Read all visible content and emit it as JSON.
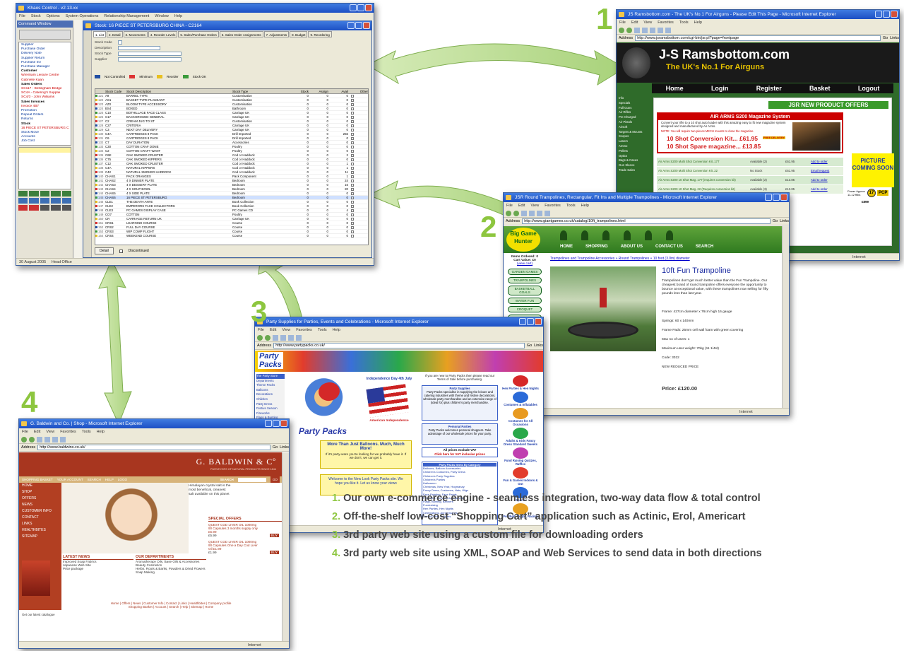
{
  "win_app": {
    "title": "Khaos Control - v2.13.xx",
    "menu": [
      "File",
      "Stock",
      "Options",
      "System Operations",
      "Relationship Management",
      "Window",
      "Help"
    ],
    "stock_title": "Stock: 16 PIECE ST PETERSBURG CHINA - C2164",
    "tabs": [
      "1. List",
      "2. Detail",
      "3. Movements",
      "4. Reorder Levels",
      "5. Sales/Purchase Orders",
      "6. Sales Order Assignments",
      "7. Adjustments",
      "8. Budget",
      "9. Reordering"
    ],
    "command_title": "Command Window",
    "command_links": [
      "Supplier",
      "Purchase Order",
      "Delivery Note",
      "Supplier Return",
      "Purchase Inv",
      "Purchase Manager",
      "Customer",
      "Wrenham Leisure Centre",
      "Gabrielle Kaan",
      "Sales Orders",
      "SC117 - Bellingham Bridge",
      "SC4A - Catering's Supplie",
      "SC4/3 - John Williams",
      "Sales Invoices",
      "Invoice 4B7",
      "Promotion",
      "Repeat Orders",
      "Returns",
      "Stock",
      "16 PIECE ST PETERSBURG C",
      "Stock Move",
      "Accounts",
      "Job Cost"
    ],
    "form_labels": [
      "Stock Code",
      "Description",
      "Stock Type",
      "Supplier"
    ],
    "status_legend": [
      "Not Controlled",
      "Minimum",
      "Reorder",
      "Stock OK"
    ],
    "grid_headers": [
      "Stock Code",
      "Stock Description",
      "Stock Type",
      "Stock",
      "Assign",
      "Avail",
      "Other"
    ],
    "grid_rows": [
      [
        "121",
        "A9",
        "BARREL TYPE",
        "Customisation",
        "0",
        "0",
        "0"
      ],
      [
        "122",
        "AS1",
        "BASKET TYPE PLANSANT",
        "Customisation",
        "0",
        "0",
        "0"
      ],
      [
        "123",
        "AZ0",
        "BLOOM TYPE ACCESSORY",
        "Customisation",
        "0",
        "0",
        "0"
      ],
      [
        "124",
        "BS4",
        "BOXED",
        "Bathroom",
        "0",
        "0",
        "0"
      ],
      [
        "125",
        "C10",
        "BOTHILLAGE FACE CLASS",
        "Carriage UK",
        "0",
        "0",
        "0"
      ],
      [
        "126",
        "C17",
        "BACKGROUND GENERAL",
        "Carriage UK",
        "0",
        "0",
        "0"
      ],
      [
        "127",
        "C2",
        "CREAM JUG TO ST",
        "Customisation",
        "0",
        "0",
        "0"
      ],
      [
        "128",
        "C27",
        "CRITERIA",
        "Carriage UK",
        "0",
        "0",
        "0"
      ],
      [
        "129",
        "C3",
        "NEXT DAY DELIVERY",
        "Carriage UK",
        "0",
        "0",
        "0"
      ],
      [
        "130",
        "C4A",
        "CARTRIDGES 8 PACK",
        "Drill Imported",
        "0",
        "0",
        "256"
      ],
      [
        "131",
        "C6",
        "CARTRIDGES 8 PACK",
        "Drill Imported",
        "0",
        "0",
        "0"
      ],
      [
        "132",
        "C7",
        "DAY DURATION",
        "Accessories",
        "0",
        "0",
        "0"
      ],
      [
        "133",
        "C30",
        "COTTON CRAF DONE",
        "Poultry",
        "0",
        "0",
        "0"
      ],
      [
        "134",
        "C2",
        "COTTON CRAFT WANT",
        "Poultry",
        "0",
        "0",
        "0"
      ],
      [
        "135",
        "C6E",
        "OAK SMOKED CRUSTER",
        "Cod or Haddock",
        "0",
        "0",
        "2"
      ],
      [
        "136",
        "C75",
        "OAK SMOKED KIPPERS",
        "Cod or Haddock",
        "0",
        "0",
        "0"
      ],
      [
        "137",
        "C12",
        "OAK SMOKED CRUSTER",
        "Cod or Haddock",
        "0",
        "0",
        "1"
      ],
      [
        "138",
        "C4A",
        "NATURAL KIPPERS",
        "Cod or Haddock",
        "0",
        "0",
        "1"
      ],
      [
        "139",
        "C42",
        "NATURAL SMOKED HADDOCK",
        "Cod or Haddock",
        "0",
        "0",
        "11"
      ],
      [
        "140",
        "CHAS1",
        "PACK ORANGES",
        "Pack Component",
        "0",
        "0",
        "1"
      ],
      [
        "141",
        "CHAS2",
        "4 X DINNER PLATE",
        "Bedroom",
        "0",
        "0",
        "24"
      ],
      [
        "142",
        "CHAS3",
        "4 X DESSERT PLATE",
        "Bedroom",
        "0",
        "0",
        "16"
      ],
      [
        "143",
        "CHAS4",
        "4 X SOUP BOWL",
        "Bedroom",
        "0",
        "0",
        "20"
      ],
      [
        "144",
        "CHAS5",
        "4 X SIDE PLATE",
        "Bedroom",
        "0",
        "0",
        "0"
      ],
      [
        "145",
        "CHAS6",
        "16 PIECE ST PETERSBURG",
        "Bedroom",
        "0",
        "0",
        "0"
      ],
      [
        "146",
        "CLE1",
        "THE DEATH ANTE",
        "Book Collection",
        "0",
        "0",
        "0"
      ],
      [
        "147",
        "CLE2",
        "EMPERORS FACE COLLECTORS",
        "Book Collection",
        "0",
        "0",
        "0"
      ],
      [
        "148",
        "CLE3",
        "PC GAMES DISPLAY CASE",
        "PC Games CD",
        "0",
        "0",
        "4"
      ],
      [
        "149",
        "CO7",
        "COTTON",
        "Poultry",
        "0",
        "0",
        "0"
      ],
      [
        "150",
        "CR",
        "CARRIAGE RETURN UK",
        "Carriage UK",
        "0",
        "0",
        "0"
      ],
      [
        "151",
        "CRS1",
        "LEARNING COURSE",
        "Course",
        "0",
        "0",
        "0"
      ],
      [
        "152",
        "CRS2",
        "FULL DAY COURSE",
        "Course",
        "0",
        "0",
        "0"
      ],
      [
        "153",
        "CRS3",
        "WIP COMP FLIGHT",
        "Course",
        "0",
        "0",
        "0"
      ],
      [
        "154",
        "CRS4",
        "WEEKEND COURSE",
        "Course",
        "0",
        "0",
        "0"
      ]
    ],
    "detail_button": "Detail",
    "discontinued_label": "Discontinued",
    "status_date": "30 August 2005",
    "status_user": "Head Office"
  },
  "win1": {
    "title": "JS Ramsbottom.com - The UK's No.1 For Airguns - Please Edit This Page - Microsoft Internet Explorer",
    "menu": [
      "File",
      "Edit",
      "View",
      "Favorites",
      "Tools",
      "Help"
    ],
    "address_label": "Address",
    "url": "http://www.jsramsbottom.com/cgi-bin/jsr.pl?page=frontpage",
    "go_label": "Go",
    "links_label": "Links",
    "logo": "J-S Ramsbottom.com",
    "tagline": "The UK's No.1 For Airguns",
    "nav": [
      "Home",
      "Login",
      "Register",
      "Basket",
      "Logout"
    ],
    "side_links": [
      "Info",
      "Specials",
      "Full Guns",
      "Air Rifles",
      "Pre Charged",
      "Air Pistols",
      "Airsoft",
      "Targets & Mounts",
      "Scopes",
      "Lasers",
      "Ammo",
      "Pellets",
      "Optics",
      "Bags & Cases",
      "Gun Sleeve",
      "Trade Sales"
    ],
    "offers_banner": "JSR NEW PRODUCT OFFERS",
    "feature_title": "AIR ARMS S200 Magazine System",
    "feature_text": "Convert your rifle to a 10 shot auto loader with this amazing easy to fit new magazine system designed and manufactured by Air Arms.",
    "feature_note": "NOTE: You will require two pieces MECH mounts to close the magazine.",
    "offer1": "10 Shot Conversion Kit... £61.95",
    "offer2": "10 Shot Spare magazine... £13.85",
    "free_delivery": "FREE DELIVERY",
    "products": [
      [
        "Air Arms S200 Multi Shot Conversion Kit .177",
        "Available (2)",
        "£61.95",
        "Add to order"
      ],
      [
        "Air Arms S200 Multi Shot Conversion Kit .22",
        "No Stock",
        "£61.95",
        "Email request"
      ],
      [
        "Air Arms S200 10 Shot Mag .177 (requires conversion kit)",
        "Available (2)",
        "£13.85",
        "Add to order"
      ],
      [
        "Air Arms S200 10 Shot Mag .22 (Requires conversion kit)",
        "Available (3)",
        "£13.85",
        "Add to order"
      ]
    ],
    "picture": "PICTURE COMING SOON",
    "power_label": "Power Approx 11-12 ftlbs",
    "power_value": "17",
    "pcp": "PCP",
    "price_tail": "£899",
    "status": "Internet"
  },
  "win2": {
    "title": "JSR Round Trampolines, Rectangular, Fit Ins and Multiple Trampolines - Microsoft Internet Explorer",
    "menu": [
      "File",
      "Edit",
      "View",
      "Favorites",
      "Tools",
      "Help"
    ],
    "address_label": "Address",
    "url": "http://www.giantgames.co.uk/catalog/10ft_trampolines.html",
    "go_label": "Go",
    "links_label": "Links",
    "logo": "Big Game Hunter",
    "nav": [
      "HOME",
      "SHOPPING",
      "ABOUT US",
      "CONTACT US",
      "SEARCH"
    ],
    "items_ordered": "Items Ordered: 0",
    "cart_value": "Cart Value: £0",
    "view_cart": "(view cart)",
    "side": [
      "GARDEN GAMES",
      "TRAMPOLINES",
      "BASKETBALL GOALS",
      "WATER FUN",
      "CROQUET",
      "TABLE GAMES"
    ],
    "breadcrumb": "Trampolines and Trampoline Accessories » Round Trampolines » 10 foot (3.0m) diameter",
    "heading": "10ft Fun Trampoline",
    "desc": "Trampolines don't get much better value than the Fun Trampoline. Our cheapest brand of round trampoline offers everyone the opportunity to bounce at exceptional value, with these trampolines now selling for fifty pounds less than last year.",
    "specs": [
      "Frame: 427cm diameter x 76cm high 16 gauge",
      "Springs: 60 x 140mm",
      "Frame Pads: 25mm cell wall foam with green covering",
      "Max no of users: 1",
      "Maximum user weight: 70kg (11 1/4st)",
      "Code: 3022",
      "NEW REDUCED PRICE"
    ],
    "price": "Price: £120.00",
    "status": "Internet"
  },
  "win3": {
    "title": "Party Supplies for Parties, Events and Celebrations - Microsoft Internet Explorer",
    "menu": [
      "File",
      "Edit",
      "View",
      "Favorites",
      "Tools",
      "Help"
    ],
    "address_label": "Address",
    "url": "http://www.partypacks.co.uk/",
    "go_label": "Go",
    "links_label": "Links",
    "logo": "Party Packs",
    "side": [
      "The Party Store",
      "Departments",
      "Theme Packs",
      "Balloons",
      "Decorations",
      "Children",
      "Party Dress",
      "Festive Season",
      "Fireworks",
      "Flags & Bunting",
      "Fundraising",
      "Games, Quizzes",
      "Jokes",
      "Party Balloons",
      "Special Offers",
      "Weddings"
    ],
    "independence": "Independence Day 4th July",
    "american": "American Independence",
    "intro": "If you are new to Party Packs then please read our Terms of Sale before purchasing.",
    "party_supplies_h": "Party Supplies",
    "party_supplies_t": "Party Packs specialise in supplying the leisure and catering industries with theme and festive decorations, wholesale party merchandise and an extensive range of (ideal for) plus children's party merchandise.",
    "personal_h": "Personal Parties",
    "personal_t": "Party Packs welcomes personal shoppers. Take advantage of our wholesale prices for your party.",
    "vat_note": "All prices exclude VAT",
    "vat_link": "Click here for VAT inclusive prices",
    "more_than": "More Than Just Balloons. Much, Much More!",
    "party_ware": "If it's party-ware you're looking for we probably have it. If we don't, we can get it.",
    "welcome": "Welcome to the New Look Party Packs site. We hope you like it. Let us know your views",
    "category_h": "Party Packs Items By Category",
    "categories": [
      "Balloons, Balloon Accessories",
      "Children's Costumes, Party Dress",
      "Children's Party Supplies",
      "Children's Parties",
      "Halloween",
      "Christmas, New Year, Hogmanay",
      "Fancy Dress, Costumes, Hats, Wigs",
      "Face Painting, Face Paints",
      "Fireworks, Firework Accessories",
      "Flags, Bunting, Banners",
      "Fundraising",
      "Hen Parties, Hen Nights",
      "Celebrations, Anniversaries",
      "Theme Party Supplies"
    ],
    "right_boxes": [
      "Hen Parties & Hen Nights",
      "Costumes & Inflatables",
      "Costumes for All Occasions",
      "Adults & Kids Fancy Dress Standard Sweets",
      "Fund Raising Quizzes, Raffles",
      "Fun & Games Indoors & Out",
      "Sports",
      "Football, Rugby, Racing"
    ],
    "status": "Internet"
  },
  "win4": {
    "title": "G. Baldwin and Co. | Shop - Microsoft Internet Explorer",
    "menu": [
      "File",
      "Edit",
      "View",
      "Favorites",
      "Tools",
      "Help"
    ],
    "address_label": "Address",
    "url": "http://www.baldwins.co.uk/",
    "go_label": "Go",
    "links_label": "Links",
    "logo": "G. BALDWIN & Cº",
    "logo_sub": "PURVEYORS OF NATURAL PRODUCTS SINCE 1844",
    "topnav": [
      "SHOPPING BASKET",
      "YOUR ACCOUNT",
      "SEARCH",
      "HELP",
      "LOGO"
    ],
    "search_label": "SEARCH",
    "go_btn": "GO",
    "side": [
      "HOME",
      "SHOP",
      "OFFERS",
      "NEWS",
      "CUSTOMER INFO",
      "CONTACT",
      "LINKS",
      "HEALTHBITES",
      "SITEMAP"
    ],
    "promo": "Himalayan crystal salt is the most beneficial, cleanest salt available on this planet",
    "special_h": "SPECIAL OFFERS",
    "special1": "QUEST COD LIVER OIL 1000mg 90 Capsules 3 months supply only £5.99",
    "special1_price": "£5.99",
    "special2": "QUEST COD LIVER OIL 1000mg 90 Capsules One a Day Cod Liver Oil £1.99",
    "special2_price": "£1.99",
    "buy": "BUY",
    "latest_h": "LATEST NEWS",
    "news": [
      "Improved Soap Fabrics",
      "Japanese Web Site",
      "Price package"
    ],
    "dept_h": "OUR DEPARTMENTS",
    "depts": [
      "Aromatherapy Oils, Base Oils & Accessories",
      "Beauty Cosmetics",
      "Herbs, Roots & Barks, Powders & Dried Flowers",
      "Soap Making"
    ],
    "footer1": "Home | Offers | News | Customer Info | Contact | Links | Healthbites | Company profile",
    "footer2": "Shopping Basket | Account | Search | Help | Sitemap | Home",
    "catalog_note": "Get our latest catalogue",
    "status": "Internet"
  },
  "labels": {
    "n1": "1",
    "n2": "2",
    "n3": "3",
    "n4": "4"
  },
  "legend": [
    {
      "n": "1.",
      "text": "Our own e-commerce engine - seamless integration, two-way data flow & total control"
    },
    {
      "n": "2.",
      "text": "Off-the-shelf low-cost “Shopping Cart” application such as Actinic, Erol, Americart"
    },
    {
      "n": "3.",
      "text": "3rd party web site using a custom file for downloading orders"
    },
    {
      "n": "4.",
      "text": "3rd party web site using XML, SOAP and Web Services to send data in both directions"
    }
  ],
  "colors": {
    "arrow": "#b7d98b",
    "accent": "#8dc63f",
    "legend_text": "#454545"
  }
}
